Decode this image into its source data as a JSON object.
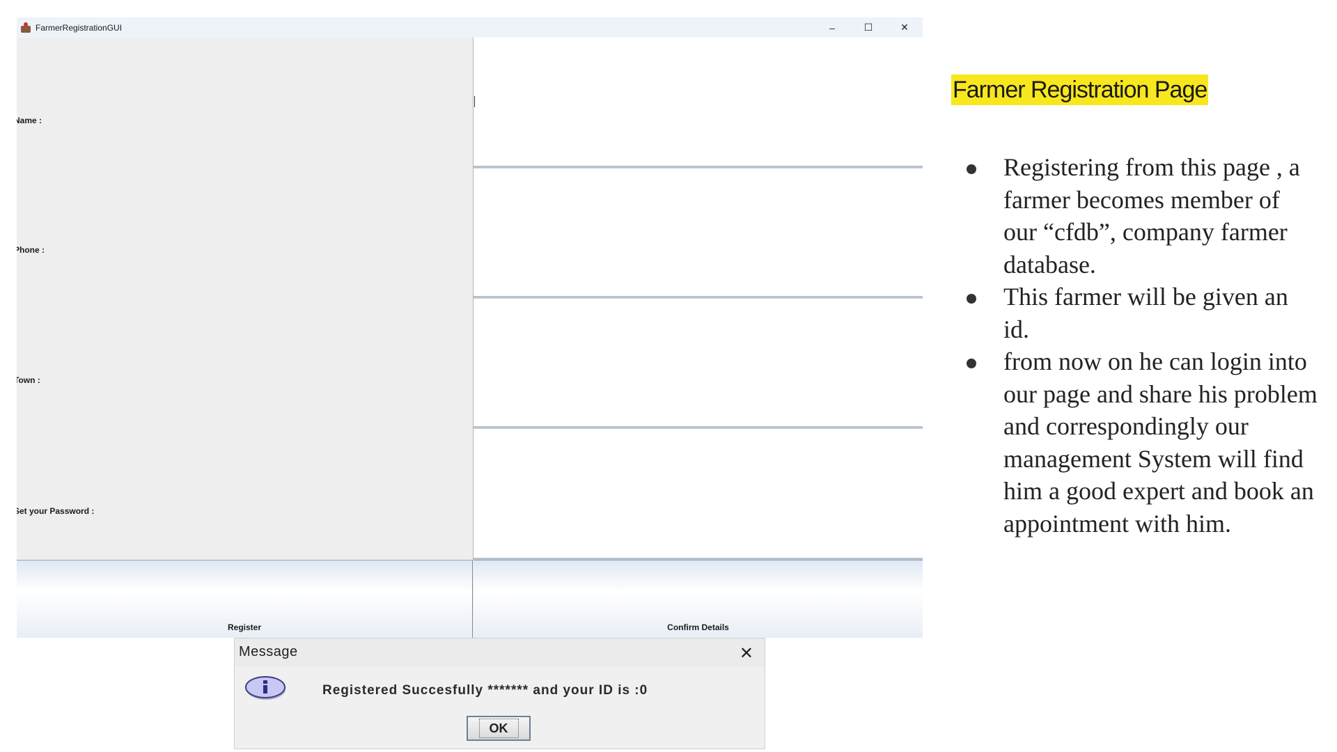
{
  "window": {
    "title": "FarmerRegistrationGUI",
    "controls": {
      "minimize": "–",
      "maximize": "☐",
      "close": "✕"
    }
  },
  "form": {
    "labels": {
      "name": "Name :",
      "phone": "Phone :",
      "town": "Town :",
      "password": "Set your Password :"
    },
    "buttons": {
      "register": "Register",
      "confirm": "Confirm Details"
    }
  },
  "dialog": {
    "title": "Message",
    "close": "✕",
    "message": "Registered Succesfully ******* and your ID is :0",
    "ok": "OK"
  },
  "slide": {
    "title": "Farmer Registration Page",
    "bullets": [
      "Registering from this page , a farmer becomes member of our “cfdb”, company farmer database.",
      "This farmer will be given an id.",
      "from now on he can login into our page and share his problem and correspondingly our management System will find him a good expert and book an appointment with him."
    ]
  },
  "colors": {
    "title_highlight": "#f8e71c",
    "window_bg": "#eeeeee",
    "field_bg": "#ffffff",
    "dialog_bg": "#f0f0f0"
  }
}
